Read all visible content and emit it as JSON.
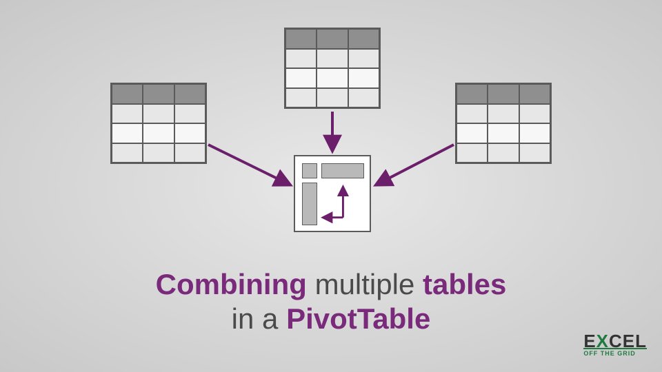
{
  "heading": {
    "w1": "Combining",
    "w2": "multiple",
    "w3": "tables",
    "w4": "in a",
    "w5": "PivotTable"
  },
  "logo": {
    "e": "E",
    "x": "X",
    "cel": "CEL",
    "tagline": "OFF THE GRID"
  },
  "colors": {
    "arrow": "#6b1f6b"
  }
}
